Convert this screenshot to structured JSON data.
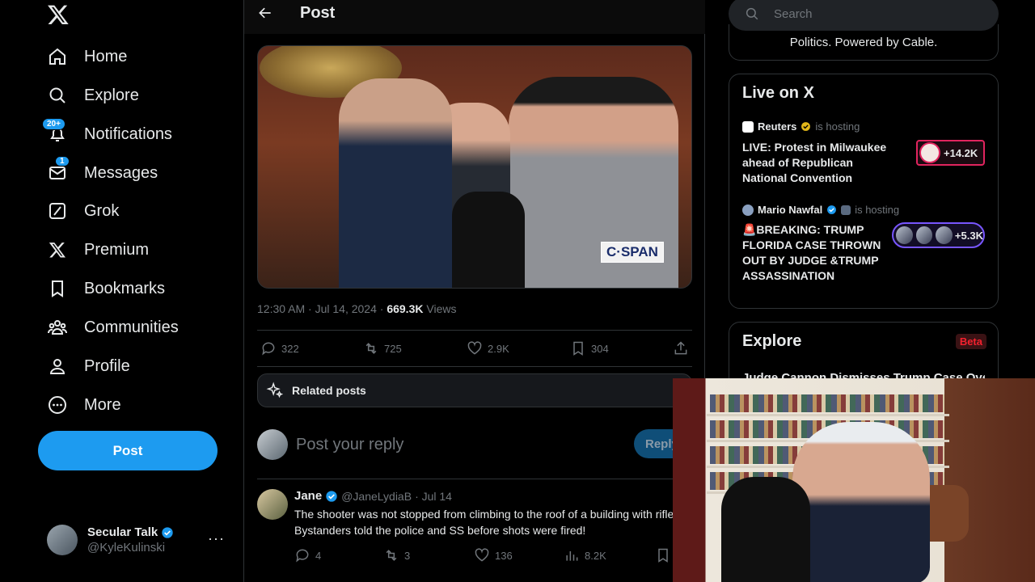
{
  "sidebar": {
    "nav": [
      {
        "label": "Home",
        "icon": "home-icon"
      },
      {
        "label": "Explore",
        "icon": "search-icon"
      },
      {
        "label": "Notifications",
        "icon": "bell-icon",
        "badge": "20+"
      },
      {
        "label": "Messages",
        "icon": "envelope-icon",
        "badge": "1"
      },
      {
        "label": "Grok",
        "icon": "grok-icon"
      },
      {
        "label": "Premium",
        "icon": "x-logo-icon"
      },
      {
        "label": "Bookmarks",
        "icon": "bookmark-icon"
      },
      {
        "label": "Communities",
        "icon": "people-icon"
      },
      {
        "label": "Profile",
        "icon": "person-icon"
      },
      {
        "label": "More",
        "icon": "more-circle-icon"
      }
    ],
    "post_button": "Post",
    "account": {
      "name": "Secular Talk",
      "handle": "@KyleKulinski"
    }
  },
  "main": {
    "title": "Post",
    "video": {
      "watermark": "C·SPAN"
    },
    "meta": {
      "time": "12:30 AM · Jul 14, 2024 · ",
      "views": "669.3K",
      "views_label": " Views"
    },
    "actions": {
      "replies": "322",
      "reposts": "725",
      "likes": "2.9K",
      "bookmarks": "304"
    },
    "related_label": "Related posts",
    "reply": {
      "placeholder": "Post your reply",
      "button": "Reply"
    },
    "comment": {
      "name": "Jane",
      "handle": "@JaneLydiaB",
      "date": "· Jul 14",
      "text": "The shooter was not stopped from climbing to the roof of a building with rifle! Bystanders told the police and SS before shots were fired!",
      "replies": "4",
      "reposts": "3",
      "likes": "136",
      "views": "8.2K"
    }
  },
  "right": {
    "search_placeholder": "Search",
    "top_card_text": "Politics. Powered by Cable.",
    "live": {
      "title": "Live on X",
      "items": [
        {
          "host": "Reuters",
          "hosting": "is hosting",
          "title": "LIVE: Protest in Milwaukee ahead of Republican National Convention",
          "count": "+14.2K"
        },
        {
          "host": "Mario Nawfal",
          "hosting": "is hosting",
          "title": "🚨BREAKING: TRUMP FLORIDA CASE THROWN OUT BY JUDGE &TRUMP ASSASSINATION",
          "count": "+5.3K"
        }
      ]
    },
    "explore": {
      "title": "Explore",
      "badge": "Beta",
      "peek": "Judge Cannon Dismisses Trump Case Over"
    }
  },
  "colors": {
    "accent": "#1d9bf0",
    "background": "#000000",
    "text": "#e7e9ea",
    "muted": "#71767b",
    "live_pink": "#e0245e",
    "live_purple": "#7856ff",
    "beta_red": "#f4212e"
  }
}
